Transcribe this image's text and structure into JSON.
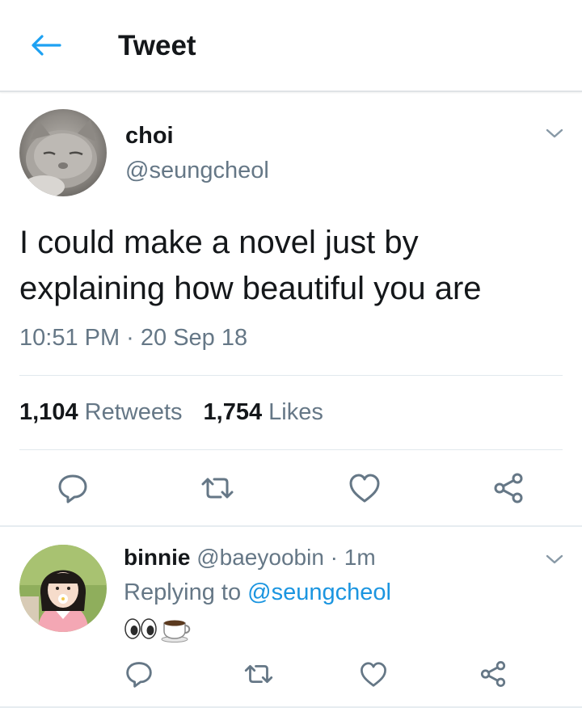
{
  "header": {
    "title": "Tweet",
    "back_icon": "arrow-left-icon",
    "accent_color": "#1da1f2"
  },
  "tweet": {
    "author_name": "choi",
    "author_handle": "@seungcheol",
    "text": "I could make a novel just by explaining how beautiful you are",
    "timestamp": "10:51 PM · 20 Sep 18",
    "retweet_count": "1,104",
    "retweet_label": "Retweets",
    "like_count": "1,754",
    "like_label": "Likes",
    "actions": [
      "reply-icon",
      "retweet-icon",
      "heart-icon",
      "share-icon"
    ]
  },
  "reply": {
    "author_name": "binnie",
    "author_handle": "@baeyoobin",
    "time": "· 1m",
    "replying_prefix": "Replying to",
    "replying_to": "@seungcheol",
    "content_emojis": [
      "eyes-emoji",
      "coffee-emoji"
    ]
  },
  "colors": {
    "text_primary": "#14171a",
    "text_secondary": "#657786",
    "link": "#1b95e0",
    "icon_gray": "#657786",
    "divider": "#e1e8ed"
  }
}
